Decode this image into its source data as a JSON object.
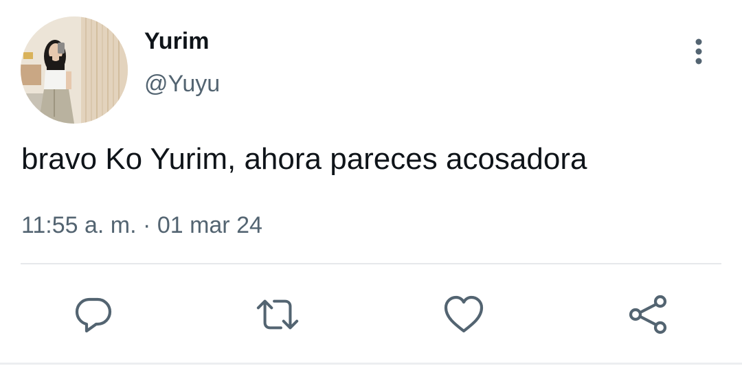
{
  "author": {
    "display_name": "Yurim",
    "handle": "@Yuyu"
  },
  "tweet": {
    "text": "bravo Ko Yurim, ahora pareces acosadora",
    "time": "11:55 a. m.",
    "separator": "·",
    "date": "01 mar 24"
  },
  "icons": {
    "more": "more-vertical-icon",
    "reply": "reply-icon",
    "retweet": "retweet-icon",
    "like": "heart-icon",
    "share": "share-icon"
  },
  "colors": {
    "text_primary": "#0f1419",
    "text_secondary": "#536471",
    "icon": "#536471",
    "divider": "#e6e8eb"
  }
}
